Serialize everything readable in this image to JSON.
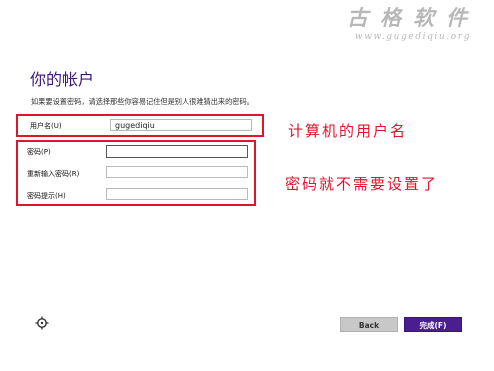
{
  "watermark": {
    "title": "古格软件",
    "url": "www.gugediqiu.org"
  },
  "page": {
    "title": "你的帐户",
    "subtitle": "如果要设置密码，请选择那些你容易记住但是别人很难猜出来的密码。"
  },
  "form": {
    "username": {
      "label": "用户名(U)",
      "value": "gugediqiu"
    },
    "password": {
      "label": "密码(P)",
      "value": ""
    },
    "password_confirm": {
      "label": "重新输入密码(R)",
      "value": ""
    },
    "password_hint": {
      "label": "密码提示(H)",
      "value": ""
    }
  },
  "annotations": {
    "username_note": "计算机的用户名",
    "password_note": "密码就不需要设置了"
  },
  "buttons": {
    "back": "Back",
    "finish": "完成(F)"
  },
  "colors": {
    "accent": "#4a1e8e",
    "annotation_red": "#e0142e",
    "title": "#3c1873"
  },
  "icons": {
    "ease_of_access": "ease-of-access-icon"
  }
}
